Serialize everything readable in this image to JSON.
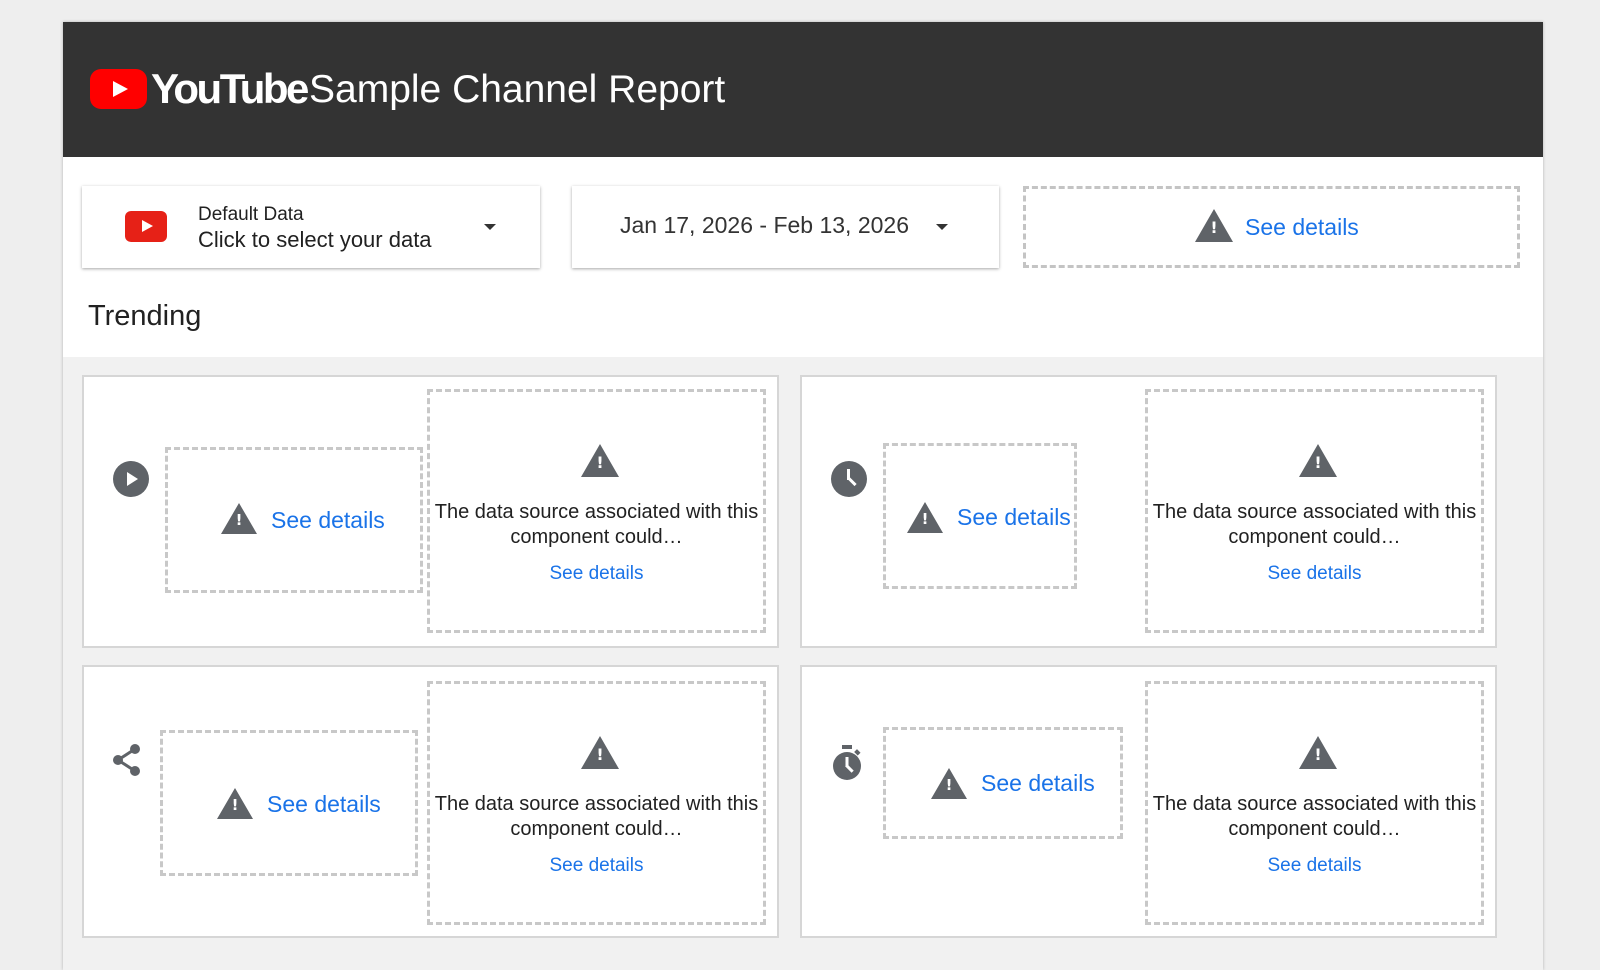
{
  "header": {
    "logo_text": "YouTube",
    "title": "Sample Channel Report"
  },
  "data_control": {
    "label": "Default Data",
    "value": "Click to select your data"
  },
  "date_control": {
    "value": "Jan 17, 2026 - Feb 13, 2026"
  },
  "error_control": {
    "link": "See details"
  },
  "section_title": "Trending",
  "cards": [
    {
      "icon": "play-circle-icon",
      "stat_link": "See details",
      "message": "The data source associated with this component could…",
      "message_link": "See details"
    },
    {
      "icon": "clock-icon",
      "stat_link": "See details",
      "message": "The data source associated with this component could…",
      "message_link": "See details"
    },
    {
      "icon": "share-icon",
      "stat_link": "See details",
      "message": "The data source associated with this component could…",
      "message_link": "See details"
    },
    {
      "icon": "timer-icon",
      "stat_link": "See details",
      "message": "The data source associated with this component could…",
      "message_link": "See details"
    }
  ],
  "colors": {
    "header_bg": "#333333",
    "brand_red": "#ff0000",
    "link_blue": "#1a73e8",
    "warning_icon": "#5f6368",
    "page_bg": "#eeeeee"
  }
}
